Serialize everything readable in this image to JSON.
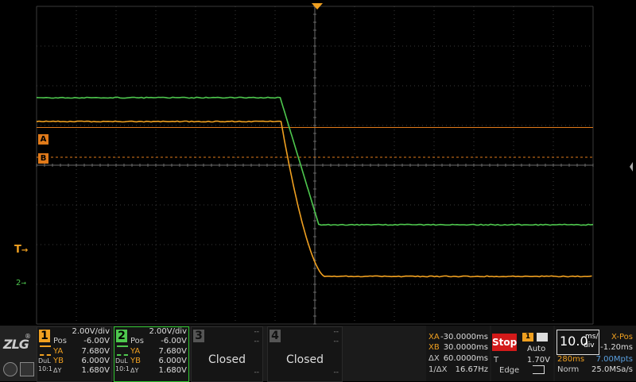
{
  "colors": {
    "ch1": "#f0a020",
    "ch2": "#4ec74e",
    "grid": "#3a3a3a",
    "cursorA": "#e07a1a",
    "cursorB": "#e07a1a",
    "stop": "#d31a1a"
  },
  "markers": {
    "cursor_a": "A",
    "cursor_b": "B",
    "trigger_level": "T",
    "ch2_ref": "2",
    "arrow": "→"
  },
  "traces": {
    "ch2_high_div": 2.3,
    "ch2_low_div": 5.5,
    "ch1_high_div": 2.9,
    "ch1_low_div": 6.8,
    "cursor_a_div": 3.05,
    "cursor_b_div": 3.8,
    "fall_start_time_div": -0.85,
    "fall_end_time_div": 0.15
  },
  "ch1": {
    "num": "1",
    "scale": "2.00V/div",
    "pos_label": "Pos",
    "pos": "-6.00V",
    "ya_label": "YA",
    "ya": "7.680V",
    "yb_label": "YB",
    "yb": "6.000V",
    "dy_label": "ΔY",
    "dy": "1.680V",
    "coupling": "DuL",
    "probe": "10:1"
  },
  "ch2": {
    "num": "2",
    "scale": "2.00V/div",
    "pos_label": "Pos",
    "pos": "-6.00V",
    "ya_label": "YA",
    "ya": "7.680V",
    "yb_label": "YB",
    "yb": "6.000V",
    "dy_label": "ΔY",
    "dy": "1.680V",
    "coupling": "DuL",
    "probe": "10:1"
  },
  "ch3": {
    "num": "3",
    "status": "Closed",
    "dash": "--"
  },
  "ch4": {
    "num": "4",
    "status": "Closed",
    "dash": "--"
  },
  "cursors": {
    "xa_label": "XA",
    "xa": "-30.0000ms",
    "xb_label": "XB",
    "xb": "30.0000ms",
    "dx_label": "ΔX",
    "dx": "60.0000ms",
    "f_label": "1/ΔX",
    "f": "16.67Hz"
  },
  "trigger": {
    "state": "Stop",
    "source": "1",
    "mode": "Auto",
    "level_label": "T",
    "level": "1.70V",
    "type": "Edge"
  },
  "timebase": {
    "value": "10.0",
    "unit_top": "ms/",
    "unit_bottom": "div",
    "xpos_label": "X-Pos",
    "xpos": "-1.20ms",
    "record_len": "280ms",
    "points": "7.00Mpts",
    "acq_mode": "Norm",
    "sample_rate": "25.0MSa/s"
  },
  "brand": "ZLG"
}
